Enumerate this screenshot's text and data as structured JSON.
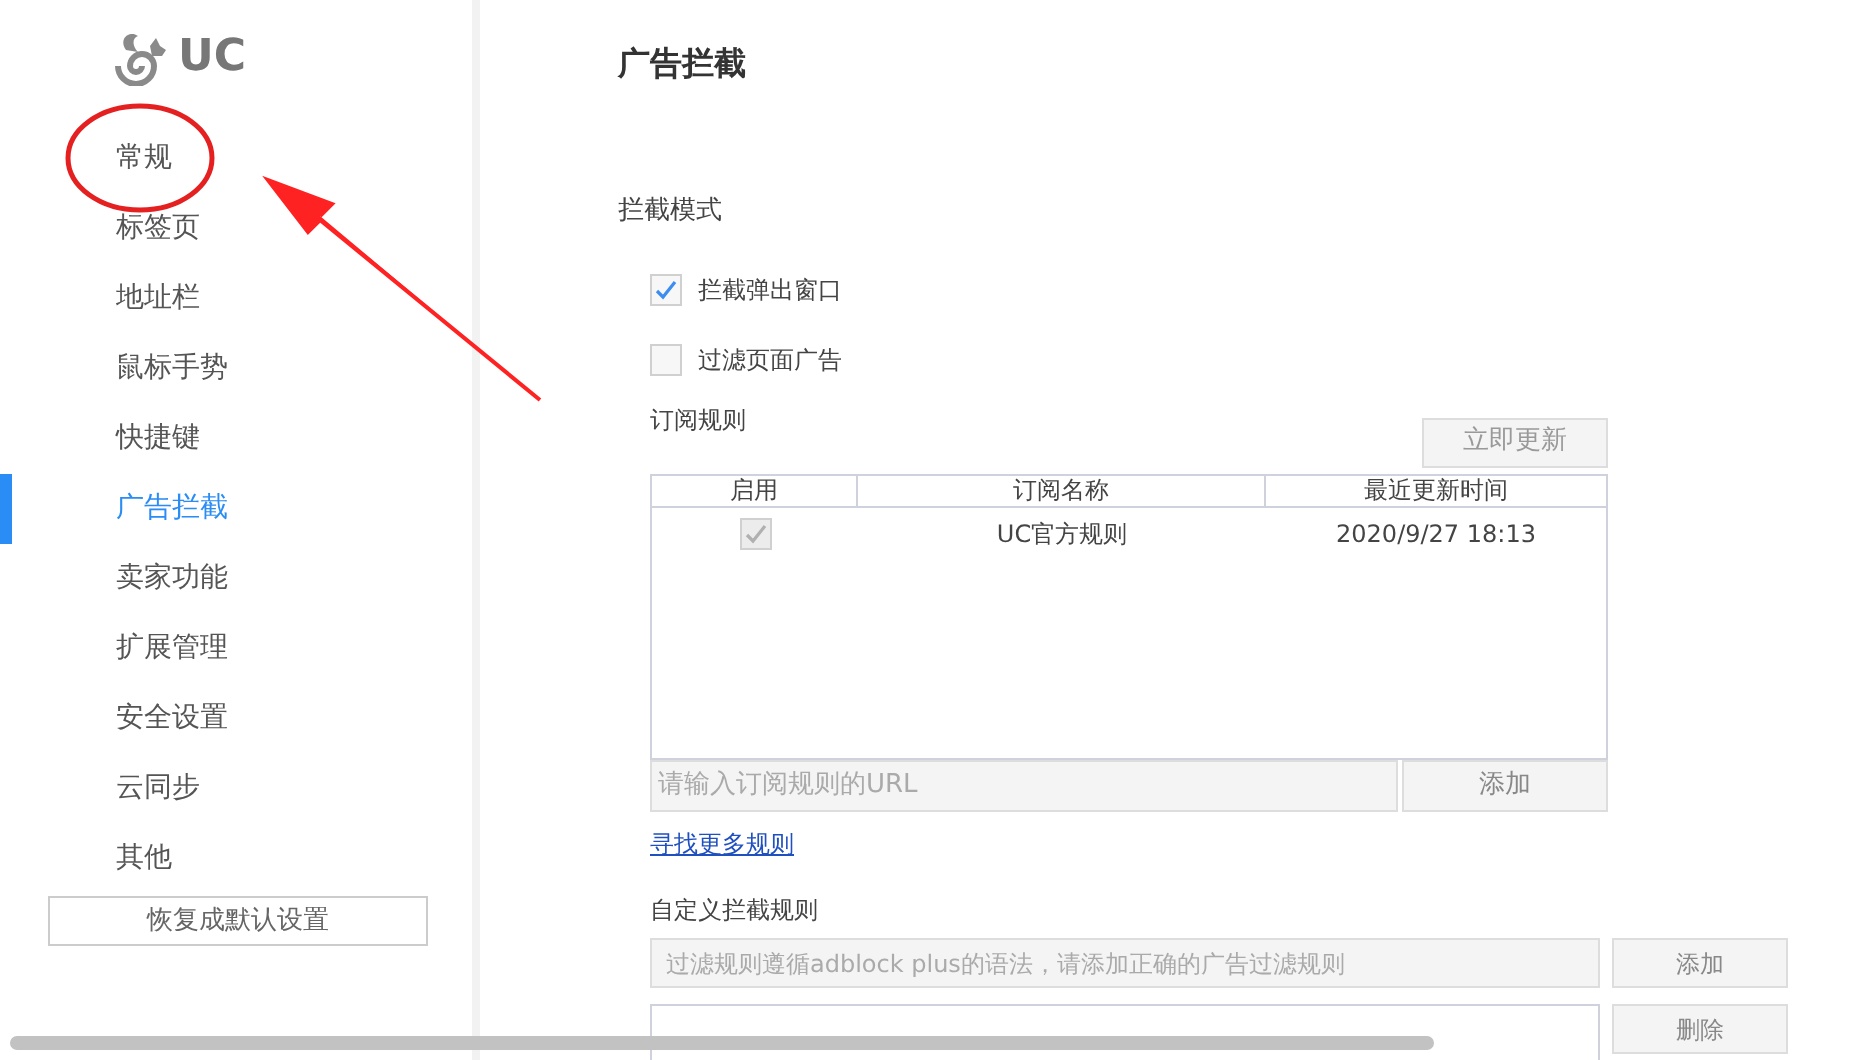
{
  "logo": {
    "text": "UC"
  },
  "sidebar": {
    "items": [
      {
        "label": "常规",
        "selected": false
      },
      {
        "label": "标签页",
        "selected": false
      },
      {
        "label": "地址栏",
        "selected": false
      },
      {
        "label": "鼠标手势",
        "selected": false
      },
      {
        "label": "快捷键",
        "selected": false
      },
      {
        "label": "广告拦截",
        "selected": true
      },
      {
        "label": "卖家功能",
        "selected": false
      },
      {
        "label": "扩展管理",
        "selected": false
      },
      {
        "label": "安全设置",
        "selected": false
      },
      {
        "label": "云同步",
        "selected": false
      },
      {
        "label": "其他",
        "selected": false
      }
    ],
    "reset_button": "恢复成默认设置"
  },
  "page_title": "广告拦截",
  "mode": {
    "title": "拦截模式",
    "options": [
      {
        "label": "拦截弹出窗口",
        "checked": true
      },
      {
        "label": "过滤页面广告",
        "checked": false
      }
    ]
  },
  "subscriptions": {
    "title": "订阅规则",
    "update_button": "立即更新",
    "table": {
      "columns": [
        "启用",
        "订阅名称",
        "最近更新时间"
      ],
      "rows": [
        {
          "enabled": true,
          "name": "UC官方规则",
          "updated": "2020/9/27 18:13"
        }
      ]
    },
    "url_field": {
      "placeholder": "请输入订阅规则的URL"
    },
    "add_button": "添加",
    "more_link": "寻找更多规则"
  },
  "custom_rules": {
    "title": "自定义拦截规则",
    "rule_field": {
      "placeholder": "过滤规则遵循adblock plus的语法，请添加正确的广告过滤规则"
    },
    "add_button": "添加",
    "delete_button": "删除"
  }
}
